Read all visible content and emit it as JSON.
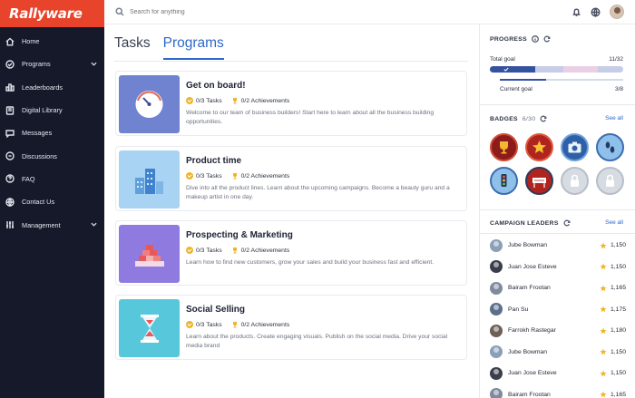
{
  "app": {
    "brand": "Rallyware"
  },
  "sidebar": {
    "items": [
      {
        "label": "Home",
        "icon": "home-icon"
      },
      {
        "label": "Programs",
        "icon": "check-circle-icon",
        "expandable": true
      },
      {
        "label": "Leaderboards",
        "icon": "leaderboard-icon"
      },
      {
        "label": "Digital Library",
        "icon": "book-icon"
      },
      {
        "label": "Messages",
        "icon": "chat-icon"
      },
      {
        "label": "Discussions",
        "icon": "discussion-icon"
      },
      {
        "label": "FAQ",
        "icon": "help-icon"
      },
      {
        "label": "Contact Us",
        "icon": "globe-icon"
      },
      {
        "label": "Management",
        "icon": "sliders-icon",
        "expandable": true
      }
    ]
  },
  "topbar": {
    "search_placeholder": "Search for anything"
  },
  "main": {
    "tabs": [
      {
        "label": "Tasks"
      },
      {
        "label": "Programs",
        "active": true
      }
    ],
    "programs": [
      {
        "title": "Get on board!",
        "tasks": "0/3 Tasks",
        "achievements": "0/2 Achievements",
        "description": "Welcome to our team of business builders! Start here to learn about all the business building opportunities.",
        "thumb_color": "#6f83d1"
      },
      {
        "title": "Product time",
        "tasks": "0/3 Tasks",
        "achievements": "0/2 Achievements",
        "description": "Dive into all the product lines. Learn about the upcoming campaigns. Become a beauty guru and a makeup artist in one day.",
        "thumb_color": "#a9d3f2"
      },
      {
        "title": "Prospecting & Marketing",
        "tasks": "0/3 Tasks",
        "achievements": "0/2 Achievements",
        "description": "Learn how to find new customers, grow your sales and build your business fast and efficient.",
        "thumb_color": "#8f7be0"
      },
      {
        "title": "Social Selling",
        "tasks": "0/3 Tasks",
        "achievements": "0/2 Achievements",
        "description": "Learn about the products. Create engaging visuals. Publish on the social media. Drive your social media brand",
        "thumb_color": "#57c8dc"
      }
    ]
  },
  "progress": {
    "title": "PROGRESS",
    "total_label": "Total goal",
    "total_value": "11/32",
    "total_fraction": 0.34,
    "current_label": "Current goal",
    "current_value": "3/8",
    "current_fraction": 0.375
  },
  "badges": {
    "title": "BADGES",
    "count": "6/30",
    "see_all": "See all",
    "items": [
      {
        "icon": "trophy-icon",
        "bg": "#8c1b1b",
        "ring": "#d24a36"
      },
      {
        "icon": "star-icon",
        "bg": "#b0241f",
        "ring": "#e05a3f"
      },
      {
        "icon": "camera-icon",
        "bg": "#2f5fa5",
        "ring": "#6fa0e0"
      },
      {
        "icon": "footprints-icon",
        "bg": "#8fc0ea",
        "ring": "#3d6db0"
      },
      {
        "icon": "traffic-light-icon",
        "bg": "#8fc0ea",
        "ring": "#3d6db0"
      },
      {
        "icon": "welcome-sign-icon",
        "bg": "#b0241f",
        "ring": "#2d3a5a"
      },
      {
        "icon": "lock-icon",
        "bg": "#d7dbe2",
        "ring": "#b8bec9"
      },
      {
        "icon": "lock-icon",
        "bg": "#d7dbe2",
        "ring": "#b8bec9"
      }
    ]
  },
  "leaders": {
    "title": "CAMPAIGN LEADERS",
    "see_all": "See all",
    "items": [
      {
        "name": "Jube Bowman",
        "score": "1,150",
        "avatar_color": "#8a9fb8"
      },
      {
        "name": "Juan Jose Esteve",
        "score": "1,150",
        "avatar_color": "#3b3f4a"
      },
      {
        "name": "Bairam Frootan",
        "score": "1,165",
        "avatar_color": "#7f8b9c"
      },
      {
        "name": "Pan Su",
        "score": "1,175",
        "avatar_color": "#5a6f8a"
      },
      {
        "name": "Farrokh Rastegar",
        "score": "1,180",
        "avatar_color": "#6e5f58"
      },
      {
        "name": "Jube Bowman",
        "score": "1,150",
        "avatar_color": "#8a9fb8"
      },
      {
        "name": "Juan Jose Esteve",
        "score": "1,150",
        "avatar_color": "#3b3f4a"
      },
      {
        "name": "Bairam Frootan",
        "score": "1,165",
        "avatar_color": "#7f8b9c"
      }
    ]
  },
  "colors": {
    "brand": "#e8432b",
    "sidebar": "#15192a",
    "accent": "#2e67c8",
    "progress": "#3552a0"
  }
}
